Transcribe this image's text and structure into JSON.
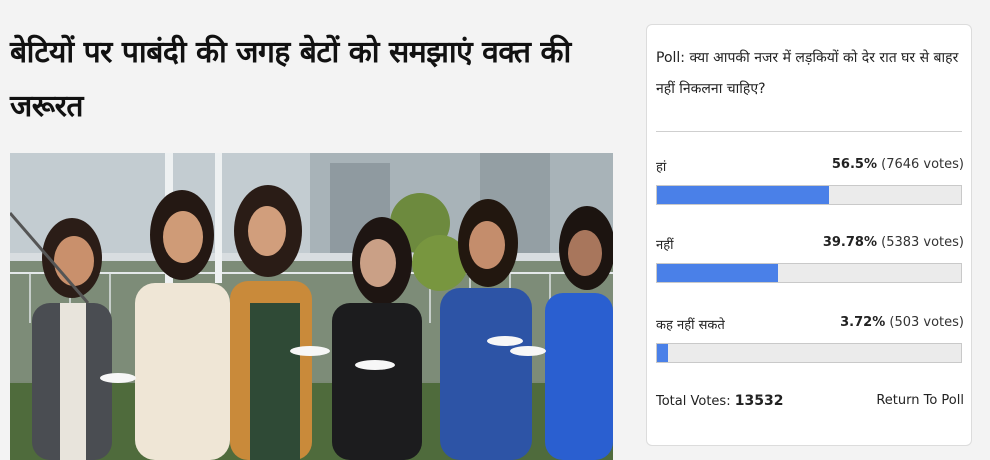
{
  "article": {
    "title": "बेटियों पर पाबंदी की जगह बेटों को समझाएं वक्त की जरूरत"
  },
  "poll": {
    "question": "Poll: क्या आपकी नजर में लड़कियों को देर रात घर से बाहर नहीं निकलना चाहिए?",
    "options": [
      {
        "label": "हां",
        "percent_text": "56.5%",
        "votes_text": "(7646 votes)",
        "fraction": 0.565
      },
      {
        "label": "नहीं",
        "percent_text": "39.78%",
        "votes_text": "(5383 votes)",
        "fraction": 0.3978
      },
      {
        "label": "कह नहीं सकते",
        "percent_text": "3.72%",
        "votes_text": "(503 votes)",
        "fraction": 0.0372
      }
    ],
    "total_label": "Total Votes:",
    "total_value": "13532",
    "return_label": "Return To Poll",
    "bar_color": "#4a80e8"
  }
}
